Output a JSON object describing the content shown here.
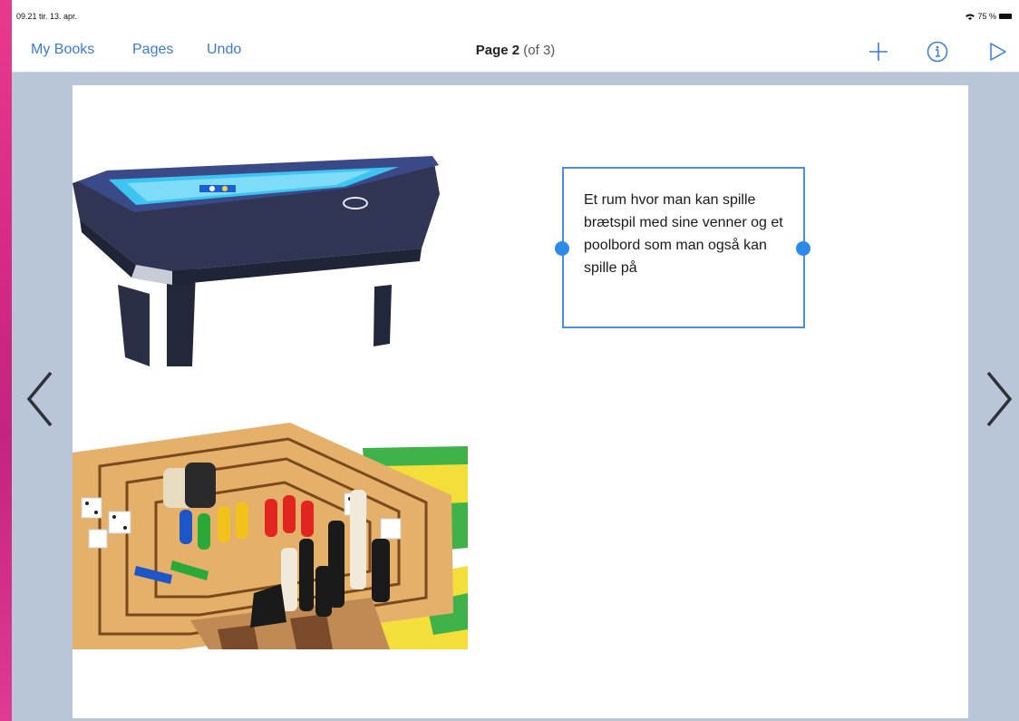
{
  "status_bar": {
    "time_date": "09.21  tir. 13. apr.",
    "battery": "75 %"
  },
  "nav": {
    "my_books": "My Books",
    "pages": "Pages",
    "undo": "Undo",
    "page_label": "Page 2",
    "page_of": "(of 3)",
    "icons": [
      "plus-icon",
      "info-icon",
      "play-icon"
    ]
  },
  "page": {
    "text_box": "Et rum hvor man kan spille brætspil med sine venner og et poolbord som man også kan spille på",
    "images": [
      "pool-table-image",
      "board-games-image"
    ]
  },
  "colors": {
    "accent": "#3a7bd5",
    "handle": "#2b8be6",
    "canvas_bg": "#b8c6d8",
    "left_strip": "#e03a92"
  }
}
